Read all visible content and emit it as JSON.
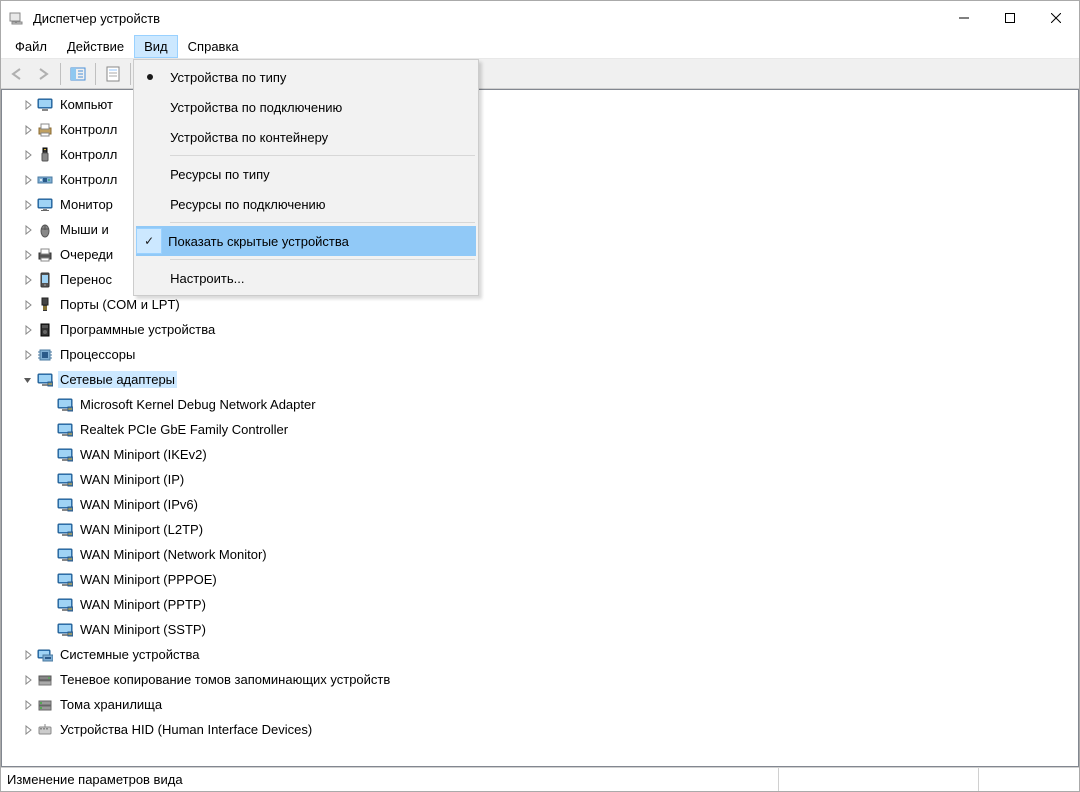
{
  "window": {
    "title": "Диспетчер устройств"
  },
  "menubar": {
    "file": "Файл",
    "action": "Действие",
    "view": "Вид",
    "help": "Справка"
  },
  "view_menu": {
    "devices_by_type": "Устройства по типу",
    "devices_by_connection": "Устройства по подключению",
    "devices_by_container": "Устройства по контейнеру",
    "resources_by_type": "Ресурсы по типу",
    "resources_by_connection": "Ресурсы по подключению",
    "show_hidden": "Показать скрытые устройства",
    "customize": "Настроить..."
  },
  "tree": {
    "items": [
      {
        "label": "Компьют",
        "icon": "computer",
        "expanded": false,
        "depth": 1
      },
      {
        "label": "Контролл",
        "icon": "printer-ctrl",
        "expanded": false,
        "depth": 1
      },
      {
        "label": "Контролл",
        "icon": "usb",
        "expanded": false,
        "depth": 1
      },
      {
        "label": "Контролл",
        "icon": "storage-ctrl",
        "expanded": false,
        "depth": 1
      },
      {
        "label": "Монитор",
        "icon": "monitor",
        "expanded": false,
        "depth": 1
      },
      {
        "label": "Мыши и",
        "icon": "mouse",
        "expanded": false,
        "depth": 1
      },
      {
        "label": "Очереди",
        "icon": "print-queue",
        "expanded": false,
        "depth": 1
      },
      {
        "label": "Перенос",
        "icon": "portable",
        "expanded": false,
        "depth": 1
      },
      {
        "label": "Порты (COM и LPT)",
        "icon": "port",
        "expanded": false,
        "depth": 1
      },
      {
        "label": "Программные устройства",
        "icon": "software",
        "expanded": false,
        "depth": 1
      },
      {
        "label": "Процессоры",
        "icon": "cpu",
        "expanded": false,
        "depth": 1
      },
      {
        "label": "Сетевые адаптеры",
        "icon": "network",
        "expanded": true,
        "depth": 1,
        "selected": true
      },
      {
        "label": "Microsoft Kernel Debug Network Adapter",
        "icon": "network",
        "depth": 2
      },
      {
        "label": "Realtek PCIe GbE Family Controller",
        "icon": "network",
        "depth": 2
      },
      {
        "label": "WAN Miniport (IKEv2)",
        "icon": "network",
        "depth": 2
      },
      {
        "label": "WAN Miniport (IP)",
        "icon": "network",
        "depth": 2
      },
      {
        "label": "WAN Miniport (IPv6)",
        "icon": "network",
        "depth": 2
      },
      {
        "label": "WAN Miniport (L2TP)",
        "icon": "network",
        "depth": 2
      },
      {
        "label": "WAN Miniport (Network Monitor)",
        "icon": "network",
        "depth": 2
      },
      {
        "label": "WAN Miniport (PPPOE)",
        "icon": "network",
        "depth": 2
      },
      {
        "label": "WAN Miniport (PPTP)",
        "icon": "network",
        "depth": 2
      },
      {
        "label": "WAN Miniport (SSTP)",
        "icon": "network",
        "depth": 2
      },
      {
        "label": "Системные устройства",
        "icon": "system",
        "expanded": false,
        "depth": 1
      },
      {
        "label": "Теневое копирование томов запоминающих устройств",
        "icon": "shadow",
        "expanded": false,
        "depth": 1
      },
      {
        "label": "Тома хранилища",
        "icon": "volume",
        "expanded": false,
        "depth": 1
      },
      {
        "label": "Устройства HID (Human Interface Devices)",
        "icon": "hid",
        "expanded": false,
        "depth": 1
      }
    ]
  },
  "statusbar": {
    "text": "Изменение параметров вида"
  }
}
